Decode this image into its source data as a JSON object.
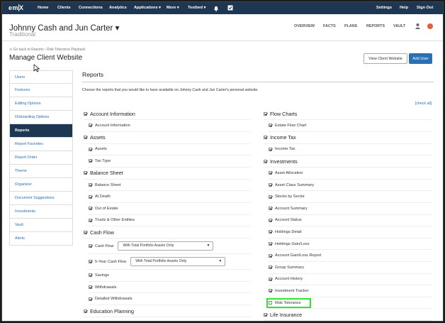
{
  "topnav": {
    "logo_a": "em",
    "logo_b": "X",
    "items": [
      "Home",
      "Clients",
      "Connections",
      "Analytics",
      "Applications ▾",
      "More ▾",
      "Testbed ▾"
    ],
    "right": [
      "Settings",
      "Help",
      "Sign Out"
    ]
  },
  "client": {
    "name": "Johnny Cash and Jun Carter ▾",
    "subtitle": "Traditional",
    "tabs": [
      "OVERVIEW",
      "FACTS",
      "PLANS",
      "REPORTS",
      "VAULT"
    ]
  },
  "breadcrumb": "⊙ Go back to Reports › Risk Tolerance Playback",
  "page_title": "Manage Client Website",
  "buttons": {
    "view": "View Client Website",
    "add": "Add User"
  },
  "sidebar": [
    {
      "label": "Users"
    },
    {
      "label": "Features"
    },
    {
      "label": "Editing Options"
    },
    {
      "label": "Onboarding Options"
    },
    {
      "label": "Reports",
      "active": true
    },
    {
      "label": "Report Favorites"
    },
    {
      "label": "Report Order"
    },
    {
      "label": "Theme"
    },
    {
      "label": "Organizer"
    },
    {
      "label": "Document Suggestions"
    },
    {
      "label": "Investments"
    },
    {
      "label": "Vault"
    },
    {
      "label": "Alerts"
    }
  ],
  "main": {
    "title": "Reports",
    "intro": "Choose the reports that you would like to have available on Johnny Cash and Jun Carter's personal website.",
    "check_all": "[check all]"
  },
  "left_col": [
    {
      "label": "Account Information",
      "kind": "cat",
      "checked": true
    },
    {
      "label": "Account Information",
      "kind": "sub",
      "checked": true
    },
    {
      "label": "Assets",
      "kind": "cat",
      "checked": true
    },
    {
      "label": "Assets",
      "kind": "sub",
      "checked": true
    },
    {
      "label": "Tax Type",
      "kind": "sub",
      "checked": true
    },
    {
      "label": "Balance Sheet",
      "kind": "cat",
      "checked": true
    },
    {
      "label": "Balance Sheet",
      "kind": "sub",
      "checked": true
    },
    {
      "label": "At Death",
      "kind": "sub",
      "checked": true
    },
    {
      "label": "Out of Estate",
      "kind": "sub",
      "checked": true
    },
    {
      "label": "Trusts & Other Entities",
      "kind": "sub",
      "checked": true
    },
    {
      "label": "Cash Flow",
      "kind": "cat",
      "checked": true
    },
    {
      "label": "Cash Flow",
      "kind": "sub",
      "checked": true,
      "select": "With Total Portfolio Assets Only"
    },
    {
      "label": "5-Year Cash Flow",
      "kind": "sub",
      "checked": true,
      "select": "With Total Portfolio Assets Only"
    },
    {
      "label": "Savings",
      "kind": "sub",
      "checked": true
    },
    {
      "label": "Withdrawals",
      "kind": "sub",
      "checked": true
    },
    {
      "label": "Detailed Withdrawals",
      "kind": "sub",
      "checked": true
    },
    {
      "label": "Education Planning",
      "kind": "cat",
      "checked": true
    }
  ],
  "right_col": [
    {
      "label": "Flow Charts",
      "kind": "cat",
      "checked": true
    },
    {
      "label": "Estate Flow Chart",
      "kind": "sub",
      "checked": true
    },
    {
      "label": "Income Tax",
      "kind": "cat",
      "checked": true
    },
    {
      "label": "Income Tax",
      "kind": "sub",
      "checked": true
    },
    {
      "label": "Investments",
      "kind": "cat",
      "checked": true
    },
    {
      "label": "Asset Allocation",
      "kind": "sub",
      "checked": true
    },
    {
      "label": "Asset Class Summary",
      "kind": "sub",
      "checked": true
    },
    {
      "label": "Stocks by Sector",
      "kind": "sub",
      "checked": true
    },
    {
      "label": "Account Summary",
      "kind": "sub",
      "checked": true
    },
    {
      "label": "Account Status",
      "kind": "sub",
      "checked": true
    },
    {
      "label": "Holdings Detail",
      "kind": "sub",
      "checked": true
    },
    {
      "label": "Holdings Gain/Loss",
      "kind": "sub",
      "checked": true
    },
    {
      "label": "Account Gain/Loss Report",
      "kind": "sub",
      "checked": true
    },
    {
      "label": "Group Summary",
      "kind": "sub",
      "checked": true
    },
    {
      "label": "Account History",
      "kind": "sub",
      "checked": true
    },
    {
      "label": "Investment Tracker",
      "kind": "sub",
      "checked": true
    },
    {
      "label": "Risk Tolerance",
      "kind": "sub",
      "checked": false
    },
    {
      "label": "Life Insurance",
      "kind": "cat",
      "checked": true
    }
  ],
  "colors": {
    "nav": "#1d3651",
    "link": "#2b6fb5",
    "highlight": "#2ce82c"
  }
}
